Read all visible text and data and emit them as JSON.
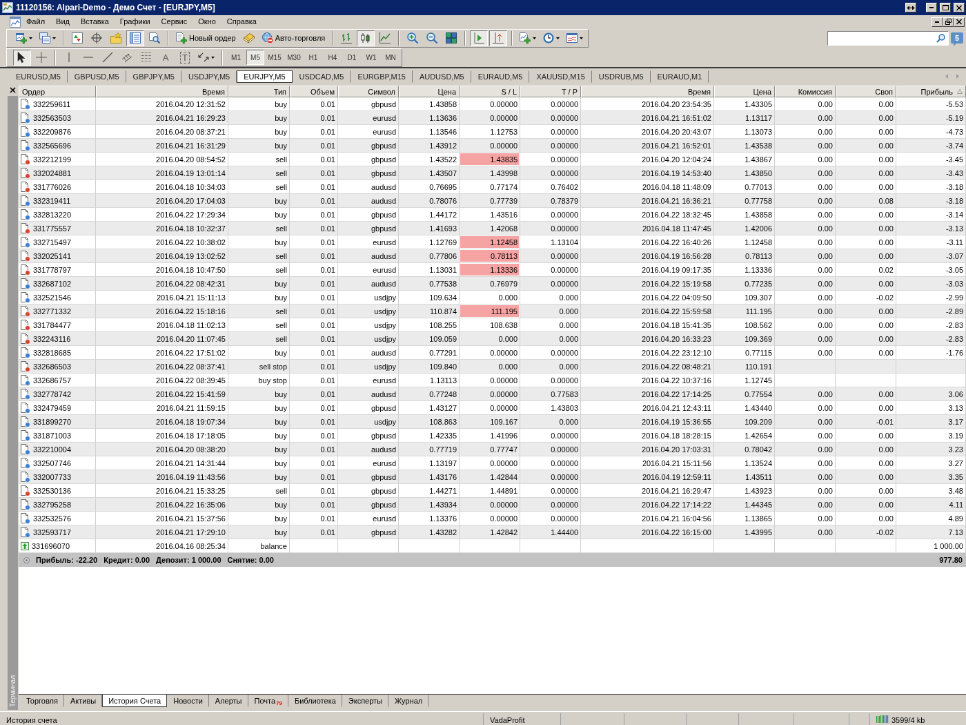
{
  "window": {
    "title": "11120156: Alpari-Demo - Демо Счет - [EURJPY,M5]"
  },
  "menu": [
    "Файл",
    "Вид",
    "Вставка",
    "Графики",
    "Сервис",
    "Окно",
    "Справка"
  ],
  "toolbar": {
    "groups": [
      [
        {
          "kind": "new-chart",
          "pressed": false,
          "dropdown": true
        },
        {
          "kind": "profiles",
          "pressed": false,
          "dropdown": true
        }
      ],
      [
        {
          "kind": "market-watch",
          "pressed": false,
          "dropdown": false
        },
        {
          "kind": "navigator",
          "pressed": false,
          "dropdown": false
        },
        {
          "kind": "favorites",
          "pressed": false,
          "dropdown": false
        },
        {
          "kind": "terminal",
          "pressed": true,
          "dropdown": false
        },
        {
          "kind": "tester",
          "pressed": false,
          "dropdown": false
        }
      ],
      [
        {
          "kind": "new-order",
          "label": "Новый ордер",
          "pressed": false,
          "dropdown": false
        },
        {
          "kind": "editor",
          "pressed": false,
          "dropdown": false
        },
        {
          "kind": "autotrading",
          "label": "Авто-торговля",
          "pressed": false,
          "dropdown": false
        }
      ],
      [
        {
          "kind": "bar-chart",
          "pressed": false,
          "dropdown": false
        },
        {
          "kind": "candles",
          "pressed": true,
          "dropdown": false
        },
        {
          "kind": "line-chart",
          "pressed": false,
          "dropdown": false
        }
      ],
      [
        {
          "kind": "zoom-in",
          "pressed": false,
          "dropdown": false
        },
        {
          "kind": "zoom-out",
          "pressed": false,
          "dropdown": false
        },
        {
          "kind": "tile",
          "pressed": false,
          "dropdown": false
        }
      ],
      [
        {
          "kind": "autoscroll",
          "pressed": true,
          "dropdown": false
        },
        {
          "kind": "chart-shift",
          "pressed": true,
          "dropdown": false
        }
      ],
      [
        {
          "kind": "indicators",
          "pressed": false,
          "dropdown": true
        },
        {
          "kind": "periods",
          "pressed": false,
          "dropdown": true
        },
        {
          "kind": "templates",
          "pressed": false,
          "dropdown": true
        }
      ]
    ]
  },
  "messages": {
    "count": "5"
  },
  "drawing_toolbar": {
    "groups": [
      [
        {
          "kind": "cursor",
          "pressed": true,
          "dropdown": false
        },
        {
          "kind": "crosshair",
          "pressed": false,
          "dropdown": false
        }
      ],
      [
        {
          "kind": "vline",
          "pressed": false,
          "dropdown": false
        },
        {
          "kind": "hline",
          "pressed": false,
          "dropdown": false
        },
        {
          "kind": "trendline",
          "pressed": false,
          "dropdown": false
        },
        {
          "kind": "channel",
          "pressed": false,
          "dropdown": false
        },
        {
          "kind": "fibonacci",
          "pressed": false,
          "dropdown": false
        },
        {
          "kind": "text",
          "label": "A",
          "pressed": false,
          "dropdown": false
        },
        {
          "kind": "label",
          "label": "T",
          "pressed": false,
          "dropdown": false
        },
        {
          "kind": "arrows",
          "pressed": false,
          "dropdown": true
        }
      ]
    ]
  },
  "timeframes": [
    {
      "label": "M1",
      "selected": false
    },
    {
      "label": "M5",
      "selected": true
    },
    {
      "label": "M15",
      "selected": false
    },
    {
      "label": "M30",
      "selected": false
    },
    {
      "label": "H1",
      "selected": false
    },
    {
      "label": "H4",
      "selected": false
    },
    {
      "label": "D1",
      "selected": false
    },
    {
      "label": "W1",
      "selected": false
    },
    {
      "label": "MN",
      "selected": false
    }
  ],
  "chart_tabs": [
    {
      "label": "EURUSD,M5",
      "selected": false
    },
    {
      "label": "GBPUSD,M5",
      "selected": false
    },
    {
      "label": "GBPJPY,M5",
      "selected": false
    },
    {
      "label": "USDJPY,M5",
      "selected": false
    },
    {
      "label": "EURJPY,M5",
      "selected": true
    },
    {
      "label": "USDCAD,M5",
      "selected": false
    },
    {
      "label": "EURGBP,M15",
      "selected": false
    },
    {
      "label": "AUDUSD,M5",
      "selected": false
    },
    {
      "label": "EURAUD,M5",
      "selected": false
    },
    {
      "label": "XAUUSD,M15",
      "selected": false
    },
    {
      "label": "USDRUB,M5",
      "selected": false
    },
    {
      "label": "EURAUD,M1",
      "selected": false
    }
  ],
  "terminal": {
    "title": "Терминал"
  },
  "table": {
    "columns": [
      {
        "label": "Ордер",
        "sorted": false
      },
      {
        "label": "Время",
        "sorted": false
      },
      {
        "label": "Тип",
        "sorted": false
      },
      {
        "label": "Объем",
        "sorted": false
      },
      {
        "label": "Символ",
        "sorted": false
      },
      {
        "label": "Цена",
        "sorted": false
      },
      {
        "label": "S / L",
        "sorted": false
      },
      {
        "label": "T / P",
        "sorted": false
      },
      {
        "label": "Время",
        "sorted": false
      },
      {
        "label": "Цена",
        "sorted": false
      },
      {
        "label": "Комиссия",
        "sorted": false
      },
      {
        "label": "Своп",
        "sorted": false
      },
      {
        "label": "Прибыль",
        "sorted": true
      }
    ],
    "rows": [
      {
        "kind": "buy",
        "sl_alert": false,
        "order": "332259611",
        "time": "2016.04.20 12:31:52",
        "type": "buy",
        "volume": "0.01",
        "symbol": "gbpusd",
        "price": "1.43858",
        "sl": "0.00000",
        "tp": "0.00000",
        "close_time": "2016.04.20 23:54:35",
        "close_price": "1.43305",
        "commission": "0.00",
        "swap": "0.00",
        "profit": "-5.53"
      },
      {
        "kind": "buy",
        "sl_alert": false,
        "order": "332563503",
        "time": "2016.04.21 16:29:23",
        "type": "buy",
        "volume": "0.01",
        "symbol": "eurusd",
        "price": "1.13636",
        "sl": "0.00000",
        "tp": "0.00000",
        "close_time": "2016.04.21 16:51:02",
        "close_price": "1.13117",
        "commission": "0.00",
        "swap": "0.00",
        "profit": "-5.19"
      },
      {
        "kind": "buy",
        "sl_alert": false,
        "order": "332209876",
        "time": "2016.04.20 08:37:21",
        "type": "buy",
        "volume": "0.01",
        "symbol": "eurusd",
        "price": "1.13546",
        "sl": "1.12753",
        "tp": "0.00000",
        "close_time": "2016.04.20 20:43:07",
        "close_price": "1.13073",
        "commission": "0.00",
        "swap": "0.00",
        "profit": "-4.73"
      },
      {
        "kind": "buy",
        "sl_alert": false,
        "order": "332565696",
        "time": "2016.04.21 16:31:29",
        "type": "buy",
        "volume": "0.01",
        "symbol": "gbpusd",
        "price": "1.43912",
        "sl": "0.00000",
        "tp": "0.00000",
        "close_time": "2016.04.21 16:52:01",
        "close_price": "1.43538",
        "commission": "0.00",
        "swap": "0.00",
        "profit": "-3.74"
      },
      {
        "kind": "sell",
        "sl_alert": true,
        "order": "332212199",
        "time": "2016.04.20 08:54:52",
        "type": "sell",
        "volume": "0.01",
        "symbol": "gbpusd",
        "price": "1.43522",
        "sl": "1.43835",
        "tp": "0.00000",
        "close_time": "2016.04.20 12:04:24",
        "close_price": "1.43867",
        "commission": "0.00",
        "swap": "0.00",
        "profit": "-3.45"
      },
      {
        "kind": "sell",
        "sl_alert": false,
        "order": "332024881",
        "time": "2016.04.19 13:01:14",
        "type": "sell",
        "volume": "0.01",
        "symbol": "gbpusd",
        "price": "1.43507",
        "sl": "1.43998",
        "tp": "0.00000",
        "close_time": "2016.04.19 14:53:40",
        "close_price": "1.43850",
        "commission": "0.00",
        "swap": "0.00",
        "profit": "-3.43"
      },
      {
        "kind": "sell",
        "sl_alert": false,
        "order": "331776026",
        "time": "2016.04.18 10:34:03",
        "type": "sell",
        "volume": "0.01",
        "symbol": "audusd",
        "price": "0.76695",
        "sl": "0.77174",
        "tp": "0.76402",
        "close_time": "2016.04.18 11:48:09",
        "close_price": "0.77013",
        "commission": "0.00",
        "swap": "0.00",
        "profit": "-3.18"
      },
      {
        "kind": "buy",
        "sl_alert": false,
        "order": "332319411",
        "time": "2016.04.20 17:04:03",
        "type": "buy",
        "volume": "0.01",
        "symbol": "audusd",
        "price": "0.78076",
        "sl": "0.77739",
        "tp": "0.78379",
        "close_time": "2016.04.21 16:36:21",
        "close_price": "0.77758",
        "commission": "0.00",
        "swap": "0.08",
        "profit": "-3.18"
      },
      {
        "kind": "buy",
        "sl_alert": false,
        "order": "332813220",
        "time": "2016.04.22 17:29:34",
        "type": "buy",
        "volume": "0.01",
        "symbol": "gbpusd",
        "price": "1.44172",
        "sl": "1.43516",
        "tp": "0.00000",
        "close_time": "2016.04.22 18:32:45",
        "close_price": "1.43858",
        "commission": "0.00",
        "swap": "0.00",
        "profit": "-3.14"
      },
      {
        "kind": "sell",
        "sl_alert": false,
        "order": "331775557",
        "time": "2016.04.18 10:32:37",
        "type": "sell",
        "volume": "0.01",
        "symbol": "gbpusd",
        "price": "1.41693",
        "sl": "1.42068",
        "tp": "0.00000",
        "close_time": "2016.04.18 11:47:45",
        "close_price": "1.42006",
        "commission": "0.00",
        "swap": "0.00",
        "profit": "-3.13"
      },
      {
        "kind": "buy",
        "sl_alert": true,
        "order": "332715497",
        "time": "2016.04.22 10:38:02",
        "type": "buy",
        "volume": "0.01",
        "symbol": "eurusd",
        "price": "1.12769",
        "sl": "1.12458",
        "tp": "1.13104",
        "close_time": "2016.04.22 16:40:26",
        "close_price": "1.12458",
        "commission": "0.00",
        "swap": "0.00",
        "profit": "-3.11"
      },
      {
        "kind": "sell",
        "sl_alert": true,
        "order": "332025141",
        "time": "2016.04.19 13:02:52",
        "type": "sell",
        "volume": "0.01",
        "symbol": "audusd",
        "price": "0.77806",
        "sl": "0.78113",
        "tp": "0.00000",
        "close_time": "2016.04.19 16:56:28",
        "close_price": "0.78113",
        "commission": "0.00",
        "swap": "0.00",
        "profit": "-3.07"
      },
      {
        "kind": "sell",
        "sl_alert": true,
        "order": "331778797",
        "time": "2016.04.18 10:47:50",
        "type": "sell",
        "volume": "0.01",
        "symbol": "eurusd",
        "price": "1.13031",
        "sl": "1.13336",
        "tp": "0.00000",
        "close_time": "2016.04.19 09:17:35",
        "close_price": "1.13336",
        "commission": "0.00",
        "swap": "0.02",
        "profit": "-3.05"
      },
      {
        "kind": "buy",
        "sl_alert": false,
        "order": "332687102",
        "time": "2016.04.22 08:42:31",
        "type": "buy",
        "volume": "0.01",
        "symbol": "audusd",
        "price": "0.77538",
        "sl": "0.76979",
        "tp": "0.00000",
        "close_time": "2016.04.22 15:19:58",
        "close_price": "0.77235",
        "commission": "0.00",
        "swap": "0.00",
        "profit": "-3.03"
      },
      {
        "kind": "buy",
        "sl_alert": false,
        "order": "332521546",
        "time": "2016.04.21 15:11:13",
        "type": "buy",
        "volume": "0.01",
        "symbol": "usdjpy",
        "price": "109.634",
        "sl": "0.000",
        "tp": "0.000",
        "close_time": "2016.04.22 04:09:50",
        "close_price": "109.307",
        "commission": "0.00",
        "swap": "-0.02",
        "profit": "-2.99"
      },
      {
        "kind": "sell",
        "sl_alert": true,
        "order": "332771332",
        "time": "2016.04.22 15:18:16",
        "type": "sell",
        "volume": "0.01",
        "symbol": "usdjpy",
        "price": "110.874",
        "sl": "111.195",
        "tp": "0.000",
        "close_time": "2016.04.22 15:59:58",
        "close_price": "111.195",
        "commission": "0.00",
        "swap": "0.00",
        "profit": "-2.89"
      },
      {
        "kind": "sell",
        "sl_alert": false,
        "order": "331784477",
        "time": "2016.04.18 11:02:13",
        "type": "sell",
        "volume": "0.01",
        "symbol": "usdjpy",
        "price": "108.255",
        "sl": "108.638",
        "tp": "0.000",
        "close_time": "2016.04.18 15:41:35",
        "close_price": "108.562",
        "commission": "0.00",
        "swap": "0.00",
        "profit": "-2.83"
      },
      {
        "kind": "sell",
        "sl_alert": false,
        "order": "332243116",
        "time": "2016.04.20 11:07:45",
        "type": "sell",
        "volume": "0.01",
        "symbol": "usdjpy",
        "price": "109.059",
        "sl": "0.000",
        "tp": "0.000",
        "close_time": "2016.04.20 16:33:23",
        "close_price": "109.369",
        "commission": "0.00",
        "swap": "0.00",
        "profit": "-2.83"
      },
      {
        "kind": "buy",
        "sl_alert": false,
        "order": "332818685",
        "time": "2016.04.22 17:51:02",
        "type": "buy",
        "volume": "0.01",
        "symbol": "audusd",
        "price": "0.77291",
        "sl": "0.00000",
        "tp": "0.00000",
        "close_time": "2016.04.22 23:12:10",
        "close_price": "0.77115",
        "commission": "0.00",
        "swap": "0.00",
        "profit": "-1.76"
      },
      {
        "kind": "sell",
        "sl_alert": false,
        "order": "332686503",
        "time": "2016.04.22 08:37:41",
        "type": "sell stop",
        "volume": "0.01",
        "symbol": "usdjpy",
        "price": "109.840",
        "sl": "0.000",
        "tp": "0.000",
        "close_time": "2016.04.22 08:48:21",
        "close_price": "110.191"
      },
      {
        "kind": "buy",
        "sl_alert": false,
        "order": "332686757",
        "time": "2016.04.22 08:39:45",
        "type": "buy stop",
        "volume": "0.01",
        "symbol": "eurusd",
        "price": "1.13113",
        "sl": "0.00000",
        "tp": "0.00000",
        "close_time": "2016.04.22 10:37:16",
        "close_price": "1.12745"
      },
      {
        "kind": "buy",
        "sl_alert": false,
        "order": "332778742",
        "time": "2016.04.22 15:41:59",
        "type": "buy",
        "volume": "0.01",
        "symbol": "audusd",
        "price": "0.77248",
        "sl": "0.00000",
        "tp": "0.77583",
        "close_time": "2016.04.22 17:14:25",
        "close_price": "0.77554",
        "commission": "0.00",
        "swap": "0.00",
        "profit": "3.06"
      },
      {
        "kind": "buy",
        "sl_alert": false,
        "order": "332479459",
        "time": "2016.04.21 11:59:15",
        "type": "buy",
        "volume": "0.01",
        "symbol": "gbpusd",
        "price": "1.43127",
        "sl": "0.00000",
        "tp": "1.43803",
        "close_time": "2016.04.21 12:43:11",
        "close_price": "1.43440",
        "commission": "0.00",
        "swap": "0.00",
        "profit": "3.13"
      },
      {
        "kind": "buy",
        "sl_alert": false,
        "order": "331899270",
        "time": "2016.04.18 19:07:34",
        "type": "buy",
        "volume": "0.01",
        "symbol": "usdjpy",
        "price": "108.863",
        "sl": "109.167",
        "tp": "0.000",
        "close_time": "2016.04.19 15:36:55",
        "close_price": "109.209",
        "commission": "0.00",
        "swap": "-0.01",
        "profit": "3.17"
      },
      {
        "kind": "buy",
        "sl_alert": false,
        "order": "331871003",
        "time": "2016.04.18 17:18:05",
        "type": "buy",
        "volume": "0.01",
        "symbol": "gbpusd",
        "price": "1.42335",
        "sl": "1.41996",
        "tp": "0.00000",
        "close_time": "2016.04.18 18:28:15",
        "close_price": "1.42654",
        "commission": "0.00",
        "swap": "0.00",
        "profit": "3.19"
      },
      {
        "kind": "buy",
        "sl_alert": false,
        "order": "332210004",
        "time": "2016.04.20 08:38:20",
        "type": "buy",
        "volume": "0.01",
        "symbol": "audusd",
        "price": "0.77719",
        "sl": "0.77747",
        "tp": "0.00000",
        "close_time": "2016.04.20 17:03:31",
        "close_price": "0.78042",
        "commission": "0.00",
        "swap": "0.00",
        "profit": "3.23"
      },
      {
        "kind": "buy",
        "sl_alert": false,
        "order": "332507746",
        "time": "2016.04.21 14:31:44",
        "type": "buy",
        "volume": "0.01",
        "symbol": "eurusd",
        "price": "1.13197",
        "sl": "0.00000",
        "tp": "0.00000",
        "close_time": "2016.04.21 15:11:56",
        "close_price": "1.13524",
        "commission": "0.00",
        "swap": "0.00",
        "profit": "3.27"
      },
      {
        "kind": "buy",
        "sl_alert": false,
        "order": "332007733",
        "time": "2016.04.19 11:43:56",
        "type": "buy",
        "volume": "0.01",
        "symbol": "gbpusd",
        "price": "1.43176",
        "sl": "1.42844",
        "tp": "0.00000",
        "close_time": "2016.04.19 12:59:11",
        "close_price": "1.43511",
        "commission": "0.00",
        "swap": "0.00",
        "profit": "3.35"
      },
      {
        "kind": "sell",
        "sl_alert": false,
        "order": "332530136",
        "time": "2016.04.21 15:33:25",
        "type": "sell",
        "volume": "0.01",
        "symbol": "gbpusd",
        "price": "1.44271",
        "sl": "1.44891",
        "tp": "0.00000",
        "close_time": "2016.04.21 16:29:47",
        "close_price": "1.43923",
        "commission": "0.00",
        "swap": "0.00",
        "profit": "3.48"
      },
      {
        "kind": "buy",
        "sl_alert": false,
        "order": "332795258",
        "time": "2016.04.22 16:35:06",
        "type": "buy",
        "volume": "0.01",
        "symbol": "gbpusd",
        "price": "1.43934",
        "sl": "0.00000",
        "tp": "0.00000",
        "close_time": "2016.04.22 17:14:22",
        "close_price": "1.44345",
        "commission": "0.00",
        "swap": "0.00",
        "profit": "4.11"
      },
      {
        "kind": "buy",
        "sl_alert": false,
        "order": "332532576",
        "time": "2016.04.21 15:37:56",
        "type": "buy",
        "volume": "0.01",
        "symbol": "eurusd",
        "price": "1.13376",
        "sl": "0.00000",
        "tp": "0.00000",
        "close_time": "2016.04.21 16:04:56",
        "close_price": "1.13865",
        "commission": "0.00",
        "swap": "0.00",
        "profit": "4.89"
      },
      {
        "kind": "buy",
        "sl_alert": false,
        "order": "332593717",
        "time": "2016.04.21 17:29:10",
        "type": "buy",
        "volume": "0.01",
        "symbol": "gbpusd",
        "price": "1.43282",
        "sl": "1.42842",
        "tp": "1.44400",
        "close_time": "2016.04.22 16:15:00",
        "close_price": "1.43995",
        "commission": "0.00",
        "swap": "-0.02",
        "profit": "7.13"
      },
      {
        "kind": "balance",
        "sl_alert": false,
        "order": "331696070",
        "time": "2016.04.16 08:25:34",
        "type": "balance",
        "profit": "1 000.00"
      }
    ],
    "summary": {
      "items": [
        "Прибыль: -22.20",
        "Кредит: 0.00",
        "Депозит: 1 000.00",
        "Снятие: 0.00"
      ],
      "total": "977.80"
    }
  },
  "terminal_tabs": [
    {
      "label": "Торговля",
      "selected": false
    },
    {
      "label": "Активы",
      "selected": false
    },
    {
      "label": "История Счета",
      "selected": true
    },
    {
      "label": "Новости",
      "selected": false
    },
    {
      "label": "Алерты",
      "selected": false
    },
    {
      "label": "Почта",
      "badge": "79",
      "selected": false
    },
    {
      "label": "Библиотека",
      "selected": false
    },
    {
      "label": "Эксперты",
      "selected": false
    },
    {
      "label": "Журнал",
      "selected": false
    }
  ],
  "status_bar": {
    "text": "История счета",
    "profile": "VadaProfit",
    "traffic": "3599/4 kb"
  }
}
